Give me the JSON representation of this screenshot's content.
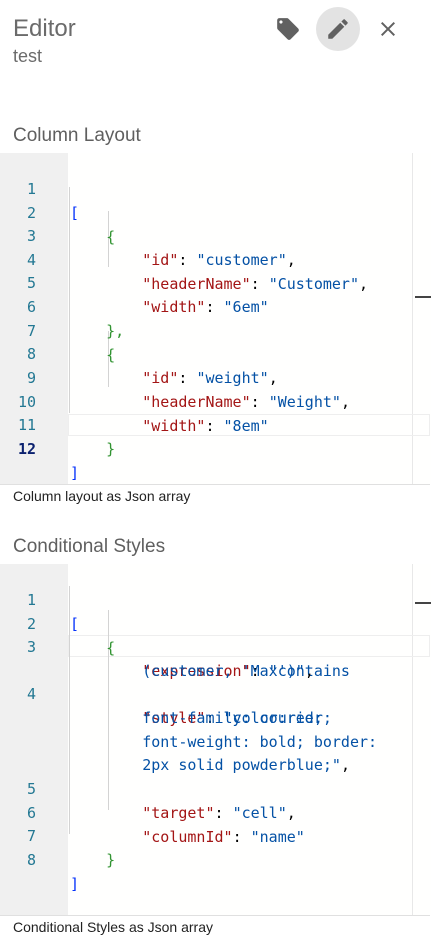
{
  "header": {
    "title": "Editor",
    "subtitle": "test"
  },
  "icons": {
    "tag": "tag-icon",
    "edit": "pencil-icon",
    "close": "close-icon"
  },
  "column_layout": {
    "label": "Column Layout",
    "helper": "Column layout as Json array",
    "line_numbers": [
      "1",
      "2",
      "3",
      "4",
      "5",
      "6",
      "7",
      "8",
      "9",
      "10",
      "11",
      "12"
    ],
    "tokens": {
      "open": "[",
      "close": "]",
      "obj_open": "{",
      "obj_close": "}",
      "obj_close_comma": "},",
      "k_id": "\"id\"",
      "v_customer": "\"customer\"",
      "k_headerName": "\"headerName\"",
      "v_Customer": "\"Customer\"",
      "k_width": "\"width\"",
      "v_6em": "\"6em\"",
      "v_weight": "\"weight\"",
      "v_Weight": "\"Weight\"",
      "v_8em": "\"8em\""
    }
  },
  "conditional_styles": {
    "label": "Conditional Styles",
    "helper": "Conditional Styles as Json array",
    "line_numbers": [
      "1",
      "2",
      "3",
      "4",
      "5",
      "6",
      "7",
      "8"
    ],
    "tokens": {
      "open": "[",
      "close": "]",
      "obj_open": "{",
      "obj_close": "}",
      "k_expression": "\"expression\"",
      "v_expression_a": "\"contains",
      "v_expression_b": "(customer, 'Max')\"",
      "k_style": "\"style\"",
      "v_style_a": "\"color:red;",
      "v_style_b": "font-family: courier;",
      "v_style_c": "font-weight: bold; border:",
      "v_style_d": "2px solid powderblue;\"",
      "k_target": "\"target\"",
      "v_cell": "\"cell\"",
      "k_columnId": "\"columnId\"",
      "v_name": "\"name\""
    }
  },
  "colors": {
    "key": "#a31515",
    "string": "#0451a5",
    "bracket_outer": "#0431fa",
    "bracket_inner": "#319331",
    "line_number": "#237893"
  }
}
